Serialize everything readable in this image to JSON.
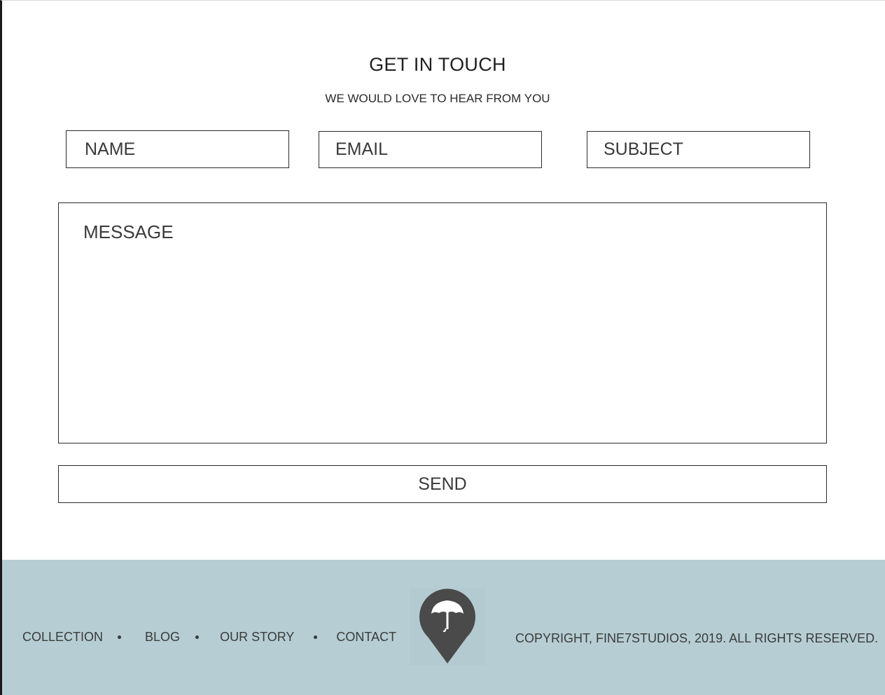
{
  "header": {
    "title": "GET IN TOUCH",
    "subtitle": "WE WOULD LOVE TO HEAR FROM YOU"
  },
  "form": {
    "name_placeholder": "NAME",
    "email_placeholder": "EMAIL",
    "subject_placeholder": "SUBJECT",
    "message_placeholder": "MESSAGE",
    "send_label": "SEND"
  },
  "footer": {
    "nav": [
      "COLLECTION",
      "BLOG",
      "OUR STORY",
      "CONTACT"
    ],
    "logo_icon": "umbrella-pin-icon",
    "copyright": "COPYRIGHT, FINE7STUDIOS, 2019. ALL RIGHTS RESERVED.",
    "background_color": "#b6ced3"
  }
}
